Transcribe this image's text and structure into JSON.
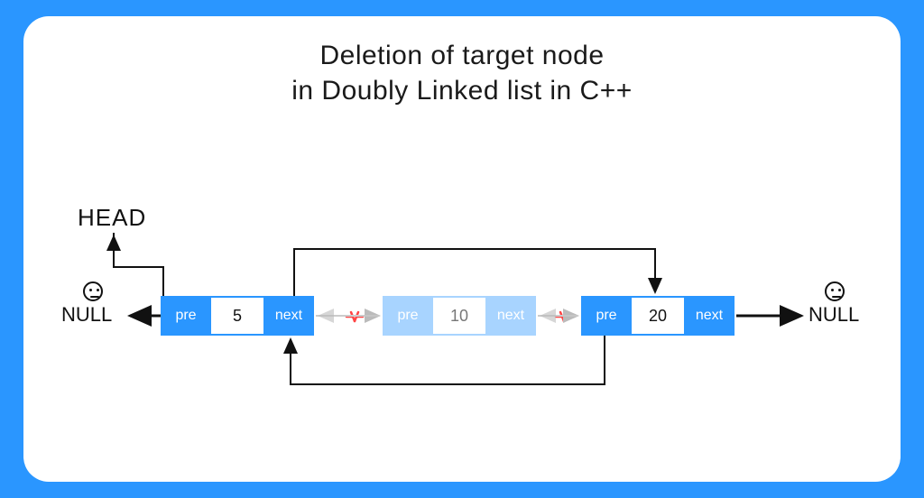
{
  "title": {
    "line1": "Deletion of target node",
    "line2": "in Doubly Linked list in C++"
  },
  "labels": {
    "head": "HEAD",
    "null_left": "NULL",
    "null_right": "NULL",
    "pre": "pre",
    "next": "next"
  },
  "nodes": [
    {
      "value": "5",
      "deleted": false
    },
    {
      "value": "10",
      "deleted": true
    },
    {
      "value": "20",
      "deleted": false
    }
  ]
}
